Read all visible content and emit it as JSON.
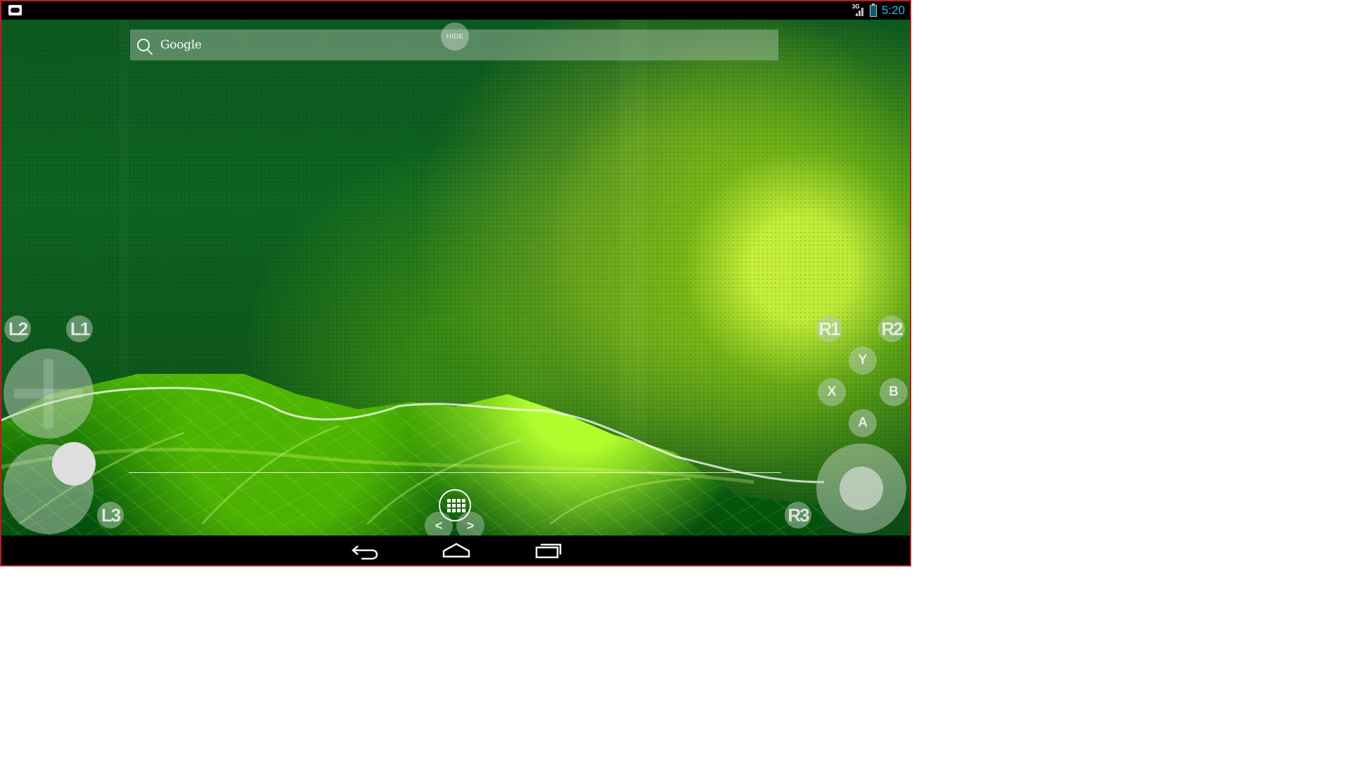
{
  "status_bar": {
    "app_icon": "gamepad-icon",
    "network_label": "3G",
    "signal_icon": "signal-icon",
    "battery_icon": "battery-icon",
    "time": "5:20",
    "accent": "#33b5e5"
  },
  "search": {
    "label": "Google",
    "icon": "search-icon"
  },
  "controls": {
    "hide": "HIDE",
    "l2": "L2",
    "l1": "L1",
    "r1": "R1",
    "r2": "R2",
    "y": "Y",
    "x": "X",
    "b": "B",
    "a": "A",
    "l3": "L3",
    "r3": "R3",
    "prev": "<",
    "next": ">"
  },
  "navigation": {
    "back_icon": "back-icon",
    "home_icon": "home-icon",
    "recents_icon": "recents-icon",
    "app_drawer_icon": "app-drawer-icon"
  },
  "colors": {
    "frame_border": "#b51d25",
    "wallpaper_green": "#0e6422",
    "leaf_highlight": "#b9ff45"
  }
}
